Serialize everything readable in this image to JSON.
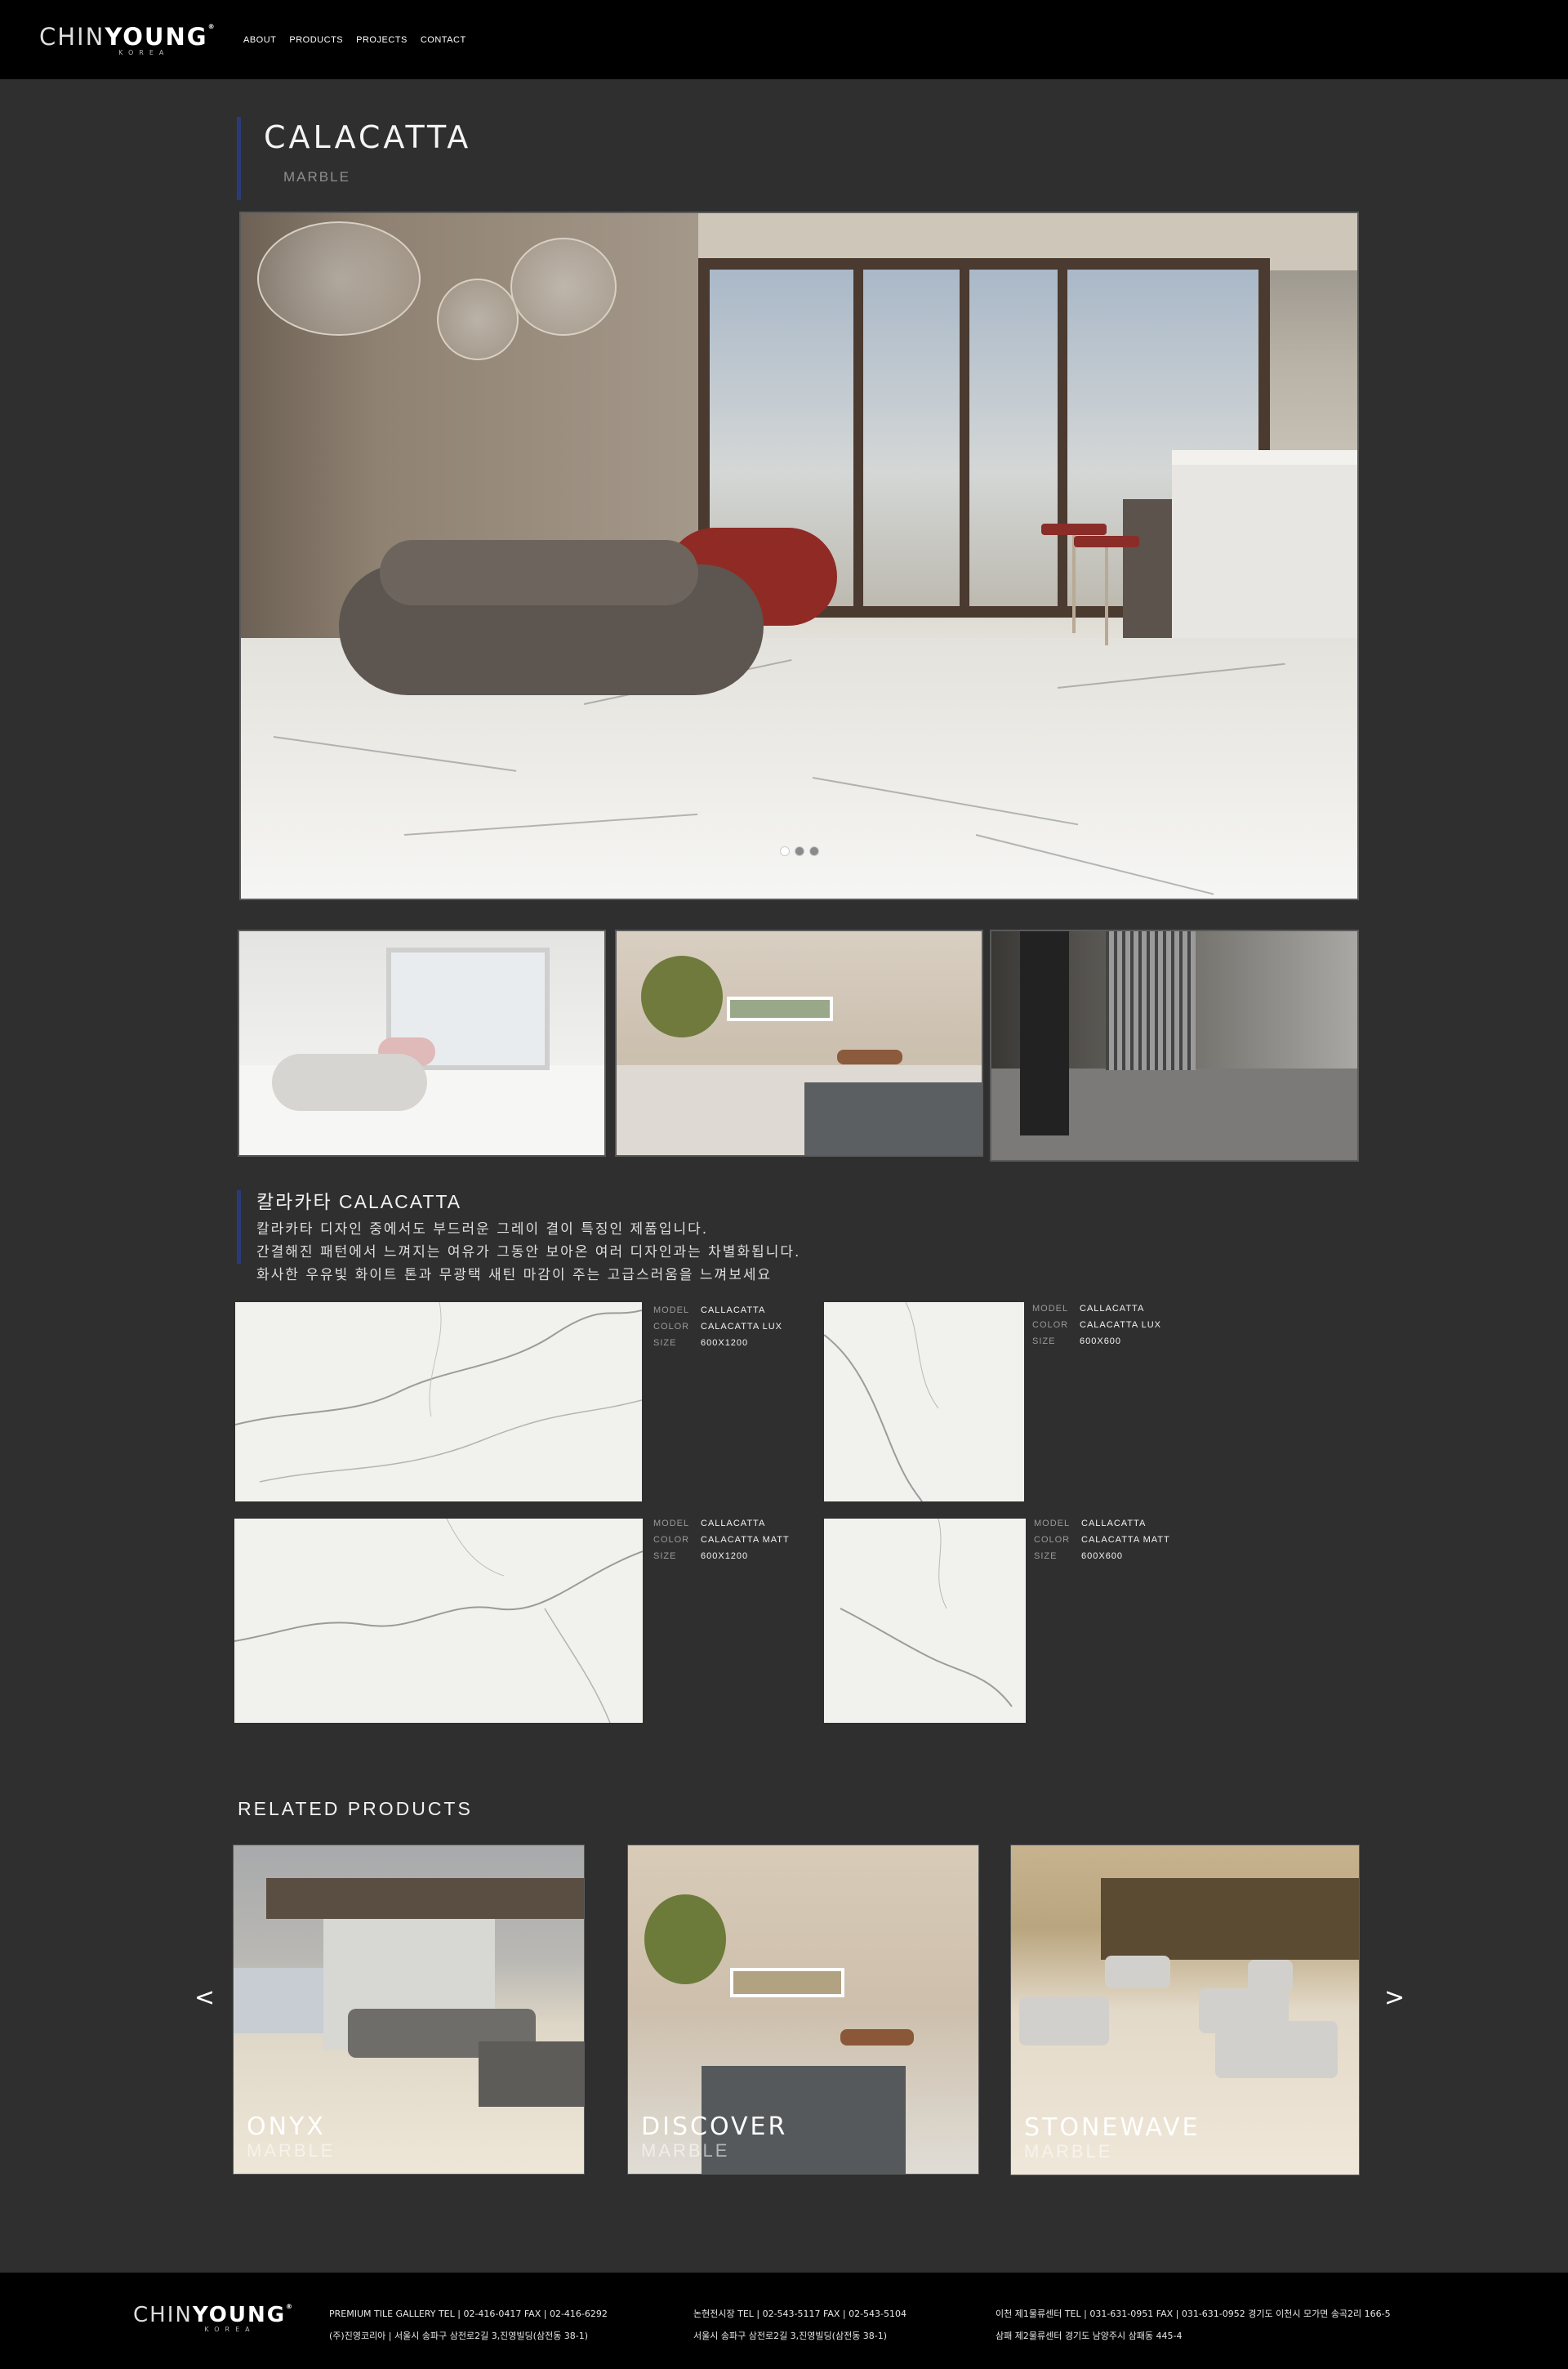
{
  "header": {
    "logo_main_bold": "CHIN",
    "logo_main_bold2": "YOUNG",
    "logo_sub": "KOREA",
    "nav": [
      "ABOUT",
      "PRODUCTS",
      "PROJECTS",
      "CONTACT"
    ]
  },
  "product": {
    "title": "CALACATTA",
    "subtitle": "MARBLE"
  },
  "description": {
    "title": "칼라카타 CALACATTA",
    "lines": [
      "칼라카타 디자인 중에서도 부드러운 그레이 결이 특징인 제품입니다.",
      "간결해진 패턴에서 느껴지는 여유가 그동안 보아온 여러 디자인과는 차별화됩니다.",
      "화사한 우유빛 화이트 톤과 무광택 새틴 마감이 주는 고급스러움을 느껴보세요"
    ]
  },
  "specs": [
    {
      "model_label": "MODEL",
      "model": "CALLACATTA",
      "color_label": "COLOR",
      "color": "CALACATTA LUX",
      "size_label": "SIZE",
      "size": "600X1200"
    },
    {
      "model_label": "MODEL",
      "model": "CALLACATTA",
      "color_label": "COLOR",
      "color": "CALACATTA LUX",
      "size_label": "SIZE",
      "size": "600X600"
    },
    {
      "model_label": "MODEL",
      "model": "CALLACATTA",
      "color_label": "COLOR",
      "color": "CALACATTA MATT",
      "size_label": "SIZE",
      "size": "600X1200"
    },
    {
      "model_label": "MODEL",
      "model": "CALLACATTA",
      "color_label": "COLOR",
      "color": "CALACATTA MATT",
      "size_label": "SIZE",
      "size": "600X600"
    }
  ],
  "related": {
    "title": "RELATED PRODUCTS",
    "prev": "<",
    "next": ">",
    "items": [
      {
        "name": "ONYX",
        "category": "MARBLE"
      },
      {
        "name": "DISCOVER",
        "category": "MARBLE"
      },
      {
        "name": "STONEWAVE",
        "category": "MARBLE"
      }
    ]
  },
  "footer": {
    "col1": [
      "PREMIUM TILE GALLERY    TEL | 02-416-0417    FAX | 02-416-6292",
      "(주)진영코리아 | 서울시 송파구 삼전로2길 3,진영빌딩(삼전동 38-1)"
    ],
    "col2": [
      "논현전시장    TEL | 02-543-5117    FAX | 02-543-5104",
      "서울시 송파구 삼전로2길 3,진영빌딩(삼전동 38-1)"
    ],
    "col3": [
      "이천 제1물류센터    TEL | 031-631-0951    FAX | 031-631-0952    경기도 이천시 모가면 송곡2리 166-5",
      "삼패 제2물류센터    경기도 남양주시 삼패동 445-4"
    ]
  },
  "colors": {
    "accent": "#2a3c78",
    "background": "#2f2f2f",
    "header": "#000000"
  }
}
